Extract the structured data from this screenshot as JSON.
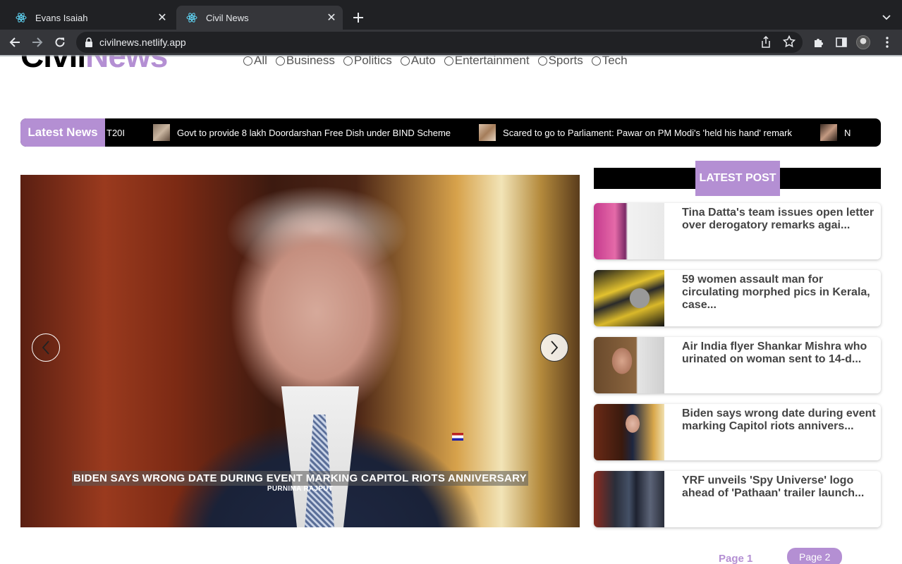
{
  "browser": {
    "tabs": [
      {
        "title": "Evans Isaiah",
        "icon": "react-icon"
      },
      {
        "title": "Civil News",
        "icon": "react-icon"
      }
    ],
    "url": "civilnews.netlify.app"
  },
  "site": {
    "logo": {
      "part1": "Civil",
      "part2": "News"
    },
    "brand_color": "#b48fd3",
    "filters": [
      "All",
      "Business",
      "Politics",
      "Auto",
      "Entertainment",
      "Sports",
      "Tech"
    ]
  },
  "ticker": {
    "label": "Latest News",
    "items": [
      "T20I",
      "Govt to provide 8 lakh Doordarshan Free Dish under BIND Scheme",
      "Scared to go to Parliament: Pawar on PM Modi's 'held his hand' remark",
      "N"
    ]
  },
  "hero": {
    "title": "BIDEN SAYS WRONG DATE DURING EVENT MARKING CAPITOL RIOTS ANNIVERSARY",
    "author": "PURNIMA RAJPUT"
  },
  "sidebar": {
    "heading": "LATEST POST",
    "posts": [
      {
        "title": "Tina Datta's team issues open letter over derogatory remarks agai..."
      },
      {
        "title": "59 women assault man for circulating morphed pics in Kerala, case..."
      },
      {
        "title": "Air India flyer Shankar Mishra who urinated on woman sent to 14-d..."
      },
      {
        "title": "Biden says wrong date during event marking Capitol riots annivers..."
      },
      {
        "title": "YRF unveils 'Spy Universe' logo ahead of 'Pathaan' trailer launch..."
      }
    ]
  },
  "pagination": {
    "page1": "Page 1",
    "page2": "Page 2"
  }
}
